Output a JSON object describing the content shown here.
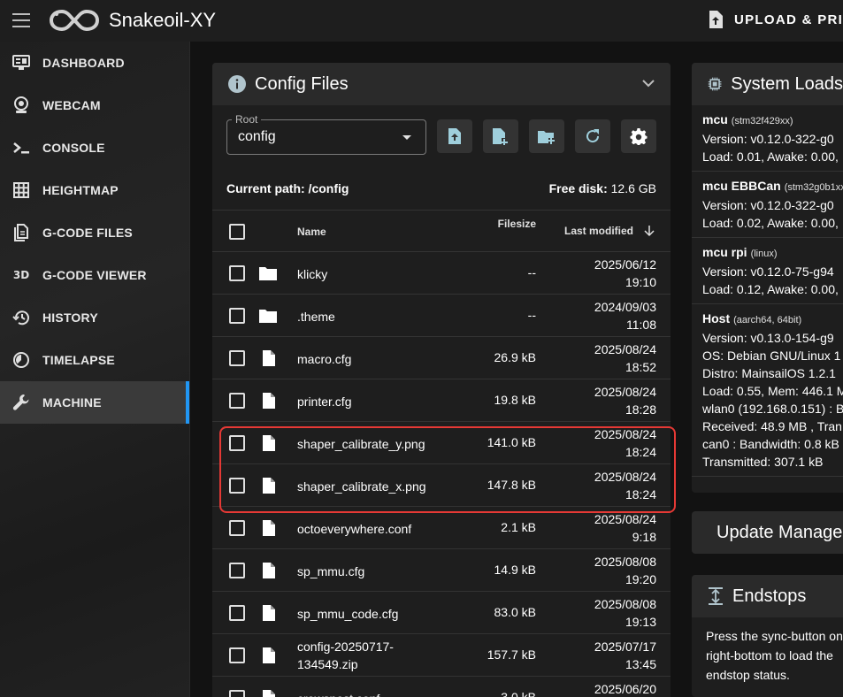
{
  "app": {
    "title": "Snakeoil-XY",
    "upload_label": "UPLOAD & PRINT"
  },
  "sidebar": {
    "items": [
      {
        "label": "DASHBOARD",
        "icon": "monitor-dashboard-icon"
      },
      {
        "label": "WEBCAM",
        "icon": "webcam-icon"
      },
      {
        "label": "CONSOLE",
        "icon": "console-icon"
      },
      {
        "label": "HEIGHTMAP",
        "icon": "grid-icon"
      },
      {
        "label": "G-CODE FILES",
        "icon": "file-document-icon"
      },
      {
        "label": "G-CODE VIEWER",
        "icon": "3d-icon"
      },
      {
        "label": "HISTORY",
        "icon": "history-icon"
      },
      {
        "label": "TIMELAPSE",
        "icon": "timelapse-icon"
      },
      {
        "label": "MACHINE",
        "icon": "wrench-icon"
      }
    ],
    "active": "MACHINE",
    "accent_color": "#2196f3"
  },
  "config_panel": {
    "title": "Config Files",
    "root_label": "Root",
    "root_value": "config",
    "current_path_label": "Current path: /config",
    "free_disk_label": "Free disk:",
    "free_disk_value": "12.6 GB",
    "columns": {
      "name": "Name",
      "size": "Filesize",
      "modified": "Last modified"
    },
    "rows": [
      {
        "name": "klicky",
        "type": "folder",
        "size": "--",
        "date": "2025/06/12",
        "time": "19:10"
      },
      {
        "name": ".theme",
        "type": "folder",
        "size": "--",
        "date": "2024/09/03",
        "time": "11:08"
      },
      {
        "name": "macro.cfg",
        "type": "file",
        "size": "26.9 kB",
        "date": "2025/08/24",
        "time": "18:52"
      },
      {
        "name": "printer.cfg",
        "type": "file",
        "size": "19.8 kB",
        "date": "2025/08/24",
        "time": "18:28"
      },
      {
        "name": "shaper_calibrate_y.png",
        "type": "file",
        "size": "141.0 kB",
        "date": "2025/08/24",
        "time": "18:24"
      },
      {
        "name": "shaper_calibrate_x.png",
        "type": "file",
        "size": "147.8 kB",
        "date": "2025/08/24",
        "time": "18:24"
      },
      {
        "name": "octoeverywhere.conf",
        "type": "file",
        "size": "2.1 kB",
        "date": "2025/08/24",
        "time": "9:18"
      },
      {
        "name": "sp_mmu.cfg",
        "type": "file",
        "size": "14.9 kB",
        "date": "2025/08/08",
        "time": "19:20"
      },
      {
        "name": "sp_mmu_code.cfg",
        "type": "file",
        "size": "83.0 kB",
        "date": "2025/08/08",
        "time": "19:13"
      },
      {
        "name": "config-20250717-",
        "name2": "134549.zip",
        "type": "file",
        "size": "157.7 kB",
        "date": "2025/07/17",
        "time": "13:45"
      },
      {
        "name": "crowsnest.conf",
        "type": "file",
        "size": "3.0 kB",
        "date": "2025/06/20",
        "time": ""
      }
    ],
    "highlight_color": "#e53935"
  },
  "system_loads": {
    "title": "System Loads",
    "mcus": [
      {
        "name": "mcu",
        "sub": "(stm32f429xx)",
        "lines": [
          "Version: v0.12.0-322-g0",
          "Load: 0.01, Awake: 0.00,"
        ]
      },
      {
        "name": "mcu EBBCan",
        "sub": "(stm32g0b1xx)",
        "lines": [
          "Version: v0.12.0-322-g0",
          "Load: 0.02, Awake: 0.00,"
        ]
      },
      {
        "name": "mcu rpi",
        "sub": "(linux)",
        "lines": [
          "Version: v0.12.0-75-g94",
          "Load: 0.12, Awake: 0.00,"
        ]
      },
      {
        "name": "Host",
        "sub": "(aarch64, 64bit)",
        "lines": [
          "Version: v0.13.0-154-g9",
          "OS: Debian GNU/Linux 1",
          "Distro: MainsailOS 1.2.1",
          "Load: 0.55, Mem: 446.1 M",
          "wlan0 (192.168.0.151) : B",
          "Received: 48.9 MB , Tran",
          "can0 : Bandwidth: 0.8 kB",
          "Transmitted: 307.1 kB"
        ]
      }
    ]
  },
  "update_panel": {
    "title": "Update Manager"
  },
  "endstops_panel": {
    "title": "Endstops",
    "text": [
      "Press the sync-button on",
      "right-bottom to load the",
      "endstop status."
    ]
  }
}
